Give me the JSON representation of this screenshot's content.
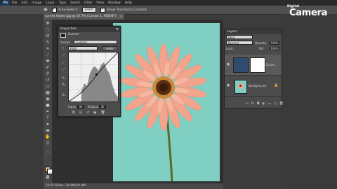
{
  "menubar": {
    "logo": "Ps",
    "items": [
      "File",
      "Edit",
      "Image",
      "Layer",
      "Type",
      "Select",
      "Filter",
      "View",
      "Window",
      "Help"
    ]
  },
  "options": {
    "auto_select_label": "Auto-Select:",
    "auto_select_value": "Layer",
    "show_transform_label": "Show Transform Controls"
  },
  "document": {
    "tab_title": "curves flower.jpg @ 16.7% (Curves 1, RGB/8*)"
  },
  "properties": {
    "header": "Properties",
    "tab": "Curves",
    "preset_label": "Preset:",
    "preset_value": "Custom",
    "channel_value": "RGB",
    "auto_button": "Auto",
    "input_label": "Input:",
    "input_value": "90",
    "output_label": "Output:",
    "output_value": "50"
  },
  "layers": {
    "header": "Layers",
    "kind_value": "Kind",
    "blend_mode": "Normal",
    "opacity_label": "Opacity:",
    "opacity_value": "100%",
    "lock_label": "Lock:",
    "fill_label": "Fill:",
    "fill_value": "100%",
    "rows": [
      {
        "name": "Curve..."
      },
      {
        "name": "Background"
      }
    ]
  },
  "status": {
    "zoom": "16.67%",
    "doc_info": "Doc: 24.9M/24.9M"
  },
  "watermark": {
    "small": "Digital",
    "big": "Camera"
  },
  "colors": {
    "image_bg": "#7fd0c3",
    "petal": "#f3a48c",
    "foreground": "#e8b98d"
  }
}
